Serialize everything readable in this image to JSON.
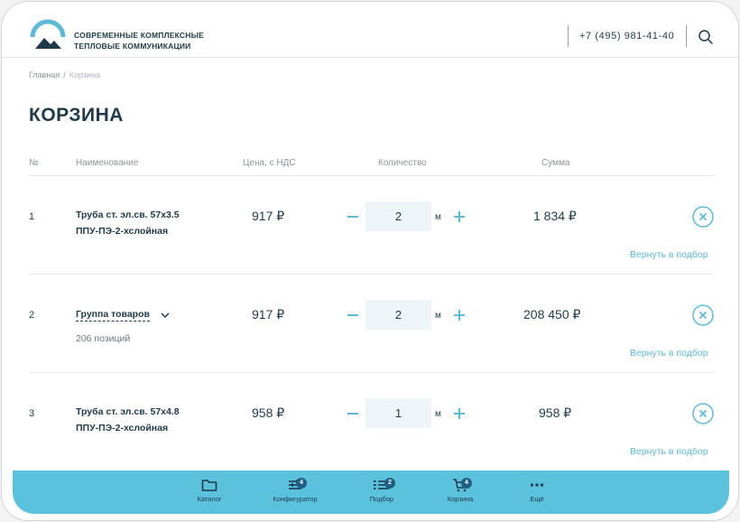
{
  "header": {
    "brand_line1": "СОВРЕМЕННЫЕ КОМПЛЕКСНЫЕ",
    "brand_line2": "ТЕПЛОВЫЕ КОММУНИКАЦИИ",
    "phone": "+7 (495) 981-41-40"
  },
  "breadcrumb": {
    "home": "Главная",
    "separator": "/",
    "current": "Корзина"
  },
  "page_title": "КОРЗИНА",
  "columns": {
    "num": "№",
    "name": "Наименование",
    "price": "Цена, с НДС",
    "qty": "Количество",
    "sum": "Сумма"
  },
  "items": [
    {
      "num": "1",
      "name_line1": "Труба ст. эл.св. 57x3.5",
      "name_line2": "ППУ-ПЭ-2-хслойная",
      "price": "917 ₽",
      "qty": "2",
      "unit": "м",
      "sum": "1 834 ₽",
      "back_label": "Вернуть в подбор"
    },
    {
      "num": "2",
      "name": "Группа товаров",
      "positions": "206 позиций",
      "price": "917 ₽",
      "qty": "2",
      "unit": "м",
      "sum": "208 450 ₽",
      "back_label": "Вернуть в подбор"
    },
    {
      "num": "3",
      "name_line1": "Труба ст. эл.св. 57x4.8",
      "name_line2": "ППУ-ПЭ-2-хслойная",
      "price": "958 ₽",
      "qty": "1",
      "unit": "м",
      "sum": "958 ₽",
      "back_label": "Вернуть в подбор"
    }
  ],
  "bottom_nav": [
    {
      "label": "Каталог",
      "icon": "folder-icon"
    },
    {
      "label": "Конфигуратор",
      "icon": "sliders-icon",
      "badge": "4"
    },
    {
      "label": "Подбор",
      "icon": "list-icon",
      "badge": "2"
    },
    {
      "label": "Корзина",
      "icon": "cart-icon",
      "badge": "4"
    },
    {
      "label": "Ещё",
      "icon": "more-icon"
    }
  ],
  "colors": {
    "accent": "#5bc2de",
    "link": "#5bbad8",
    "text_dark": "#1f3a4a",
    "badge": "#1f5f86",
    "qty_bg": "#eef5f8"
  }
}
